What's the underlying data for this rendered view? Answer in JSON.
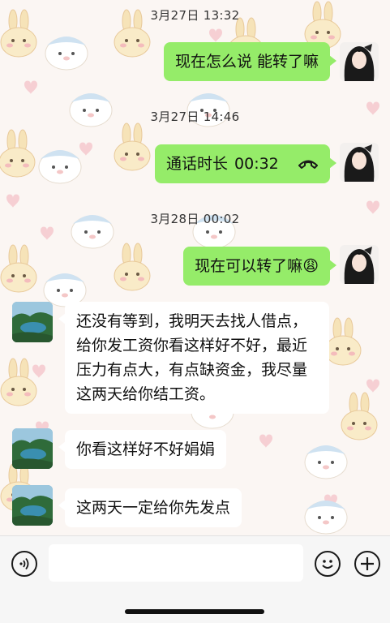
{
  "messages": [
    {
      "type": "timestamp",
      "text": "3月27日 13:32"
    },
    {
      "type": "me",
      "text": "现在怎么说 能转了嘛"
    },
    {
      "type": "timestamp",
      "text": "3月27日 14:46"
    },
    {
      "type": "me_call",
      "label": "通话时长",
      "duration": "00:32",
      "icon": "hangup-phone-icon"
    },
    {
      "type": "timestamp",
      "text": "3月28日 00:02"
    },
    {
      "type": "me",
      "text": "现在可以转了嘛",
      "emoji": "😩"
    },
    {
      "type": "other",
      "text": "还没有等到，我明天去找人借点，给你发工资你看这样好不好，最近压力有点大，有点缺资金，我尽量这两天给你结工资。"
    },
    {
      "type": "other",
      "text": "你看这样好不好娟娟"
    },
    {
      "type": "other",
      "text": "这两天一定给你先发点"
    }
  ],
  "input_bar": {
    "voice_icon": "voice-icon",
    "emoji_icon": "emoji-icon",
    "plus_icon": "plus-icon",
    "text_value": ""
  },
  "colors": {
    "my_bubble": "#95ec69",
    "their_bubble": "#ffffff",
    "wallpaper": "#fbf6f3"
  }
}
